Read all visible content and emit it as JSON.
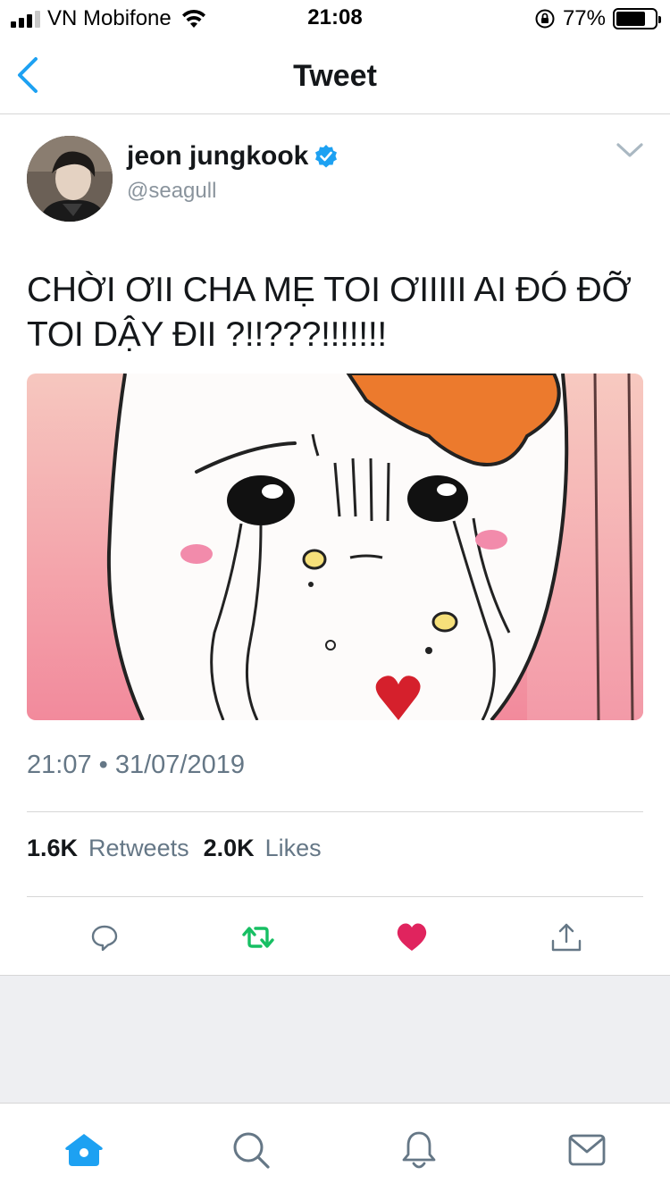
{
  "status_bar": {
    "carrier": "VN Mobifone",
    "time": "21:08",
    "battery_percent": "77%",
    "battery_level": 0.77,
    "signal_bars_on": 3,
    "signal_bars_total": 4
  },
  "nav": {
    "title": "Tweet",
    "back_icon": "chevron-left-icon"
  },
  "tweet": {
    "display_name": "jeon jungkook",
    "handle": "@seagull",
    "verified": true,
    "text": "CHỜI ƠII CHA MẸ TOI ƠIIIII AI ĐÓ ĐỠ TOI DẬY ĐII ?!!???!!!!!!!",
    "timestamp": "21:07 • 31/07/2019",
    "retweets_count": "1.6K",
    "retweets_label": "Retweets",
    "likes_count": "2.0K",
    "likes_label": "Likes"
  },
  "actions": [
    {
      "icon": "reply-icon"
    },
    {
      "icon": "retweet-icon"
    },
    {
      "icon": "like-icon"
    },
    {
      "icon": "share-icon"
    }
  ],
  "tab_bar": [
    {
      "icon": "home-icon",
      "active": true
    },
    {
      "icon": "search-icon",
      "active": false
    },
    {
      "icon": "notifications-icon",
      "active": false
    },
    {
      "icon": "messages-icon",
      "active": false
    }
  ],
  "colors": {
    "twitter_blue": "#1da1f2",
    "retweet_green": "#17bf63",
    "like_red": "#e0245e",
    "icon_grey": "#657786"
  }
}
